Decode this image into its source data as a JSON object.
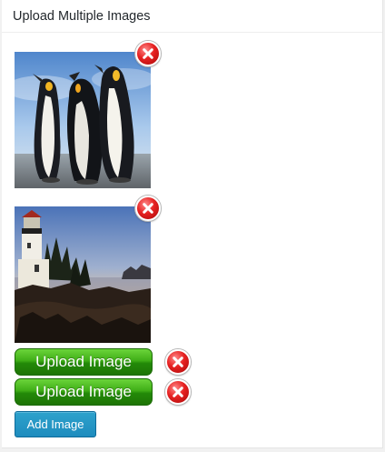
{
  "panel": {
    "title": "Upload Multiple Images"
  },
  "images": [
    {
      "subject": "penguins",
      "delete_icon": "red-circle-x-icon"
    },
    {
      "subject": "lighthouse",
      "delete_icon": "red-circle-x-icon"
    }
  ],
  "upload_buttons": [
    {
      "label": "Upload Image"
    },
    {
      "label": "Upload Image"
    }
  ],
  "add_button": {
    "label": "Add Image"
  },
  "colors": {
    "upload_green": "#3fae17",
    "delete_red": "#e62121",
    "add_blue": "#2ea2cc"
  }
}
